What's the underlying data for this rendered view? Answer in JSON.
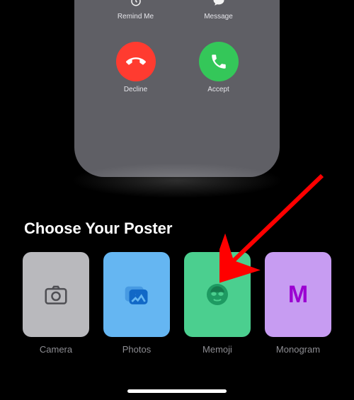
{
  "preview": {
    "remind": {
      "label": "Remind Me"
    },
    "message": {
      "label": "Message"
    },
    "decline": {
      "label": "Decline"
    },
    "accept": {
      "label": "Accept"
    }
  },
  "section": {
    "title": "Choose Your Poster"
  },
  "posters": {
    "camera": {
      "label": "Camera"
    },
    "photos": {
      "label": "Photos"
    },
    "memoji": {
      "label": "Memoji"
    },
    "monogram": {
      "label": "Monogram",
      "letter": "M"
    }
  }
}
